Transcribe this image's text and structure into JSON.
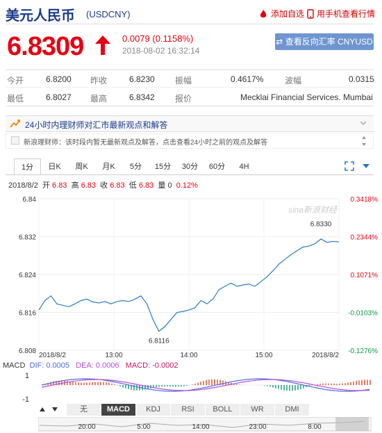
{
  "header": {
    "title": "美元人民币",
    "code": "(USDCNY)",
    "add_watch": "添加自选",
    "mobile_view": "用手机查看行情"
  },
  "quote": {
    "price": "6.8309",
    "change": "0.0079 (0.1158%)",
    "datetime": "2018-08-02 16:32:14",
    "reverse_button": "查看反向汇率 CNYUSD"
  },
  "stats": [
    {
      "label": "今开",
      "value": "6.8200"
    },
    {
      "label": "昨收",
      "value": "6.8230"
    },
    {
      "label": "振幅",
      "value": "0.4617%"
    },
    {
      "label": "波幅",
      "value": "0.0315"
    },
    {
      "label": "最低",
      "value": "6.8027"
    },
    {
      "label": "最高",
      "value": "6.8342"
    },
    {
      "label": "报价",
      "value": "Mecklai Financial Services. Mumbai"
    }
  ],
  "news": {
    "title": "24小时内理财师对汇市最新观点和解答",
    "message": "新浪理财师：该时段内暂无最新观点及解答，点击查看24小时之前的观点及解答"
  },
  "period_tabs": [
    "1分",
    "日K",
    "周K",
    "月K",
    "5分",
    "15分",
    "30分",
    "60分",
    "4H"
  ],
  "active_tab": "1分",
  "infoline": {
    "date": "2018/8/2",
    "open_label": "开",
    "open": "6.83",
    "high_label": "高",
    "high": "6.83",
    "close_label": "收",
    "close": "6.83",
    "low_label": "低",
    "low": "6.83",
    "vol_label": "量",
    "vol": "0",
    "pct": "0.12%"
  },
  "watermark": "sina新浪财经",
  "indicator_tabs": [
    "无",
    "MACD",
    "KDJ",
    "RSI",
    "BOLL",
    "WR",
    "DMI"
  ],
  "active_indicator": "MACD",
  "macd": {
    "label": "MACD",
    "dif": "DIF: 0.0005",
    "dea": "DEA: 0.0006",
    "macd": "MACD: -0.0002",
    "ytick_top": "1",
    "ytick_bot": "-1"
  },
  "colors": {
    "up": "#e60012",
    "down": "#0a9a4a",
    "line": "#2a7bc8",
    "accent": "#1a3a8a"
  },
  "chart_data": {
    "type": "line",
    "y_ticks": [
      "6.84",
      "6.832",
      "6.824",
      "6.816",
      "6.808"
    ],
    "ylim": [
      6.808,
      6.84
    ],
    "pct_ticks": [
      "0.3418%",
      "0.2344%",
      "0.1071%",
      "-0.0103%",
      "-0.1276%"
    ],
    "x_ticks": [
      "2018/8/2",
      "13:00",
      "14:00",
      "15:00",
      "2018/8/2"
    ],
    "annotations": [
      {
        "label": "6.8330",
        "value": 6.833
      },
      {
        "label": "6.8116",
        "value": 6.8116
      }
    ],
    "x": [
      0,
      2,
      4,
      6,
      8,
      10,
      12,
      14,
      16,
      18,
      20,
      22,
      24,
      26,
      28,
      30,
      32,
      34,
      36,
      38,
      40,
      42,
      44,
      46,
      48,
      50,
      52,
      54,
      56,
      58,
      60,
      62,
      64,
      66,
      68,
      70,
      72,
      74,
      76,
      78,
      80,
      82,
      84,
      86,
      88,
      90,
      92,
      94,
      96,
      98,
      100
    ],
    "values": [
      6.8165,
      6.8185,
      6.8195,
      6.8178,
      6.8175,
      6.8172,
      6.8178,
      6.8185,
      6.8188,
      6.8182,
      6.818,
      6.8183,
      6.8178,
      6.8183,
      6.8185,
      6.8183,
      6.8188,
      6.8195,
      6.8178,
      6.8145,
      6.812,
      6.813,
      6.8145,
      6.816,
      6.8162,
      6.8165,
      6.817,
      6.8185,
      6.8178,
      6.8188,
      6.8208,
      6.8215,
      6.8222,
      6.8215,
      6.8218,
      6.822,
      6.8215,
      6.8225,
      6.8235,
      6.8248,
      6.8262,
      6.8272,
      6.8282,
      6.829,
      6.8298,
      6.83,
      6.8305,
      6.8315,
      6.8308,
      6.831,
      6.8309
    ],
    "navigator_ticks": [
      "20:00",
      "5:00",
      "14:00",
      "23:00",
      "8:00"
    ]
  }
}
